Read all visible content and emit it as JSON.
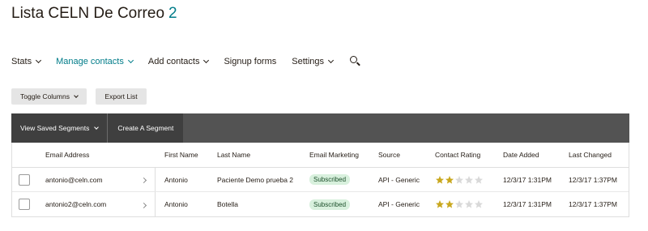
{
  "header": {
    "title": "Lista CELN De Correo",
    "count": "2"
  },
  "nav": {
    "items": [
      {
        "label": "Stats",
        "has_dropdown": true
      },
      {
        "label": "Manage contacts",
        "has_dropdown": true,
        "active": true
      },
      {
        "label": "Add contacts",
        "has_dropdown": true
      },
      {
        "label": "Signup forms",
        "has_dropdown": false
      },
      {
        "label": "Settings",
        "has_dropdown": true
      }
    ],
    "search_icon": "search-icon"
  },
  "toolbar": {
    "toggle_columns_label": "Toggle Columns",
    "export_list_label": "Export List"
  },
  "segments": {
    "view_saved_label": "View Saved Segments",
    "create_label": "Create A Segment"
  },
  "table": {
    "columns": [
      "Email Address",
      "First Name",
      "Last Name",
      "Email Marketing",
      "Source",
      "Contact Rating",
      "Date Added",
      "Last Changed"
    ],
    "rows": [
      {
        "email": "antonio@celn.com",
        "first_name": "Antonio",
        "last_name": "Paciente Demo prueba 2",
        "email_marketing": "Subscribed",
        "source": "API - Generic",
        "rating": 2,
        "rating_max": 5,
        "date_added": "12/3/17 1:31PM",
        "last_changed": "12/3/17 1:37PM"
      },
      {
        "email": "antonio2@celn.com",
        "first_name": "Antonio",
        "last_name": "Botella",
        "email_marketing": "Subscribed",
        "source": "API - Generic",
        "rating": 2,
        "rating_max": 5,
        "date_added": "12/3/17 1:31PM",
        "last_changed": "12/3/17 1:37PM"
      }
    ]
  },
  "colors": {
    "accent": "#007c89",
    "star_filled": "#c9a81f",
    "star_empty": "#d9d9d9",
    "badge_bg": "#d8f0dd",
    "segment_bar": "#535353"
  }
}
